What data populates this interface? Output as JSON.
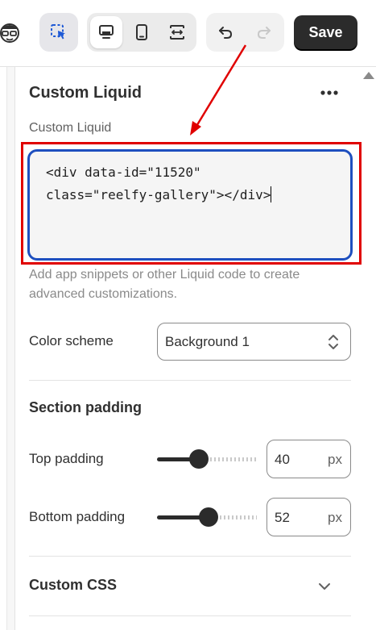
{
  "toolbar": {
    "save_label": "Save",
    "icons": [
      "avatar-icon",
      "inspect-icon",
      "desktop-icon",
      "mobile-icon",
      "fullwidth-icon",
      "undo-icon",
      "redo-icon"
    ]
  },
  "panel": {
    "title": "Custom Liquid",
    "field_label": "Custom Liquid",
    "code_value": "<div data-id=\"11520\"\nclass=\"reelfy-gallery\"></div>",
    "help_text": "Add app snippets or other Liquid code to create advanced customizations.",
    "color_scheme": {
      "label": "Color scheme",
      "selected": "Background 1"
    },
    "section_padding": {
      "title": "Section padding",
      "top": {
        "label": "Top padding",
        "value": "40",
        "unit": "px",
        "fraction": 0.42
      },
      "bottom": {
        "label": "Bottom padding",
        "value": "52",
        "unit": "px",
        "fraction": 0.52
      }
    },
    "custom_css": {
      "title": "Custom CSS"
    }
  },
  "colors": {
    "accent_focus": "#1e4fbf",
    "annotation_red": "#e00000",
    "save_bg": "#2b2b2b"
  }
}
